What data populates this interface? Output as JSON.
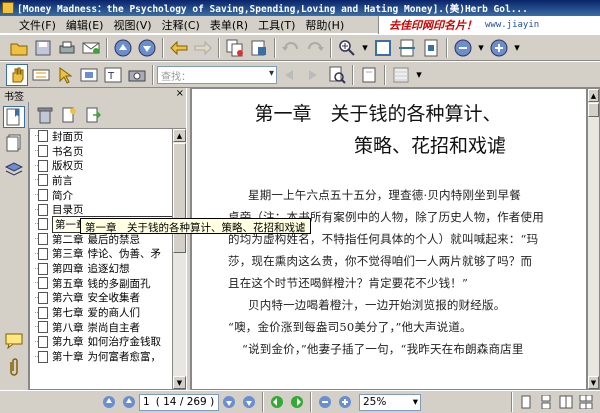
{
  "window": {
    "title": "[Money  Madness：the Psychology of Saving,Spending,Loving and Hating Money].(美)Herb Gol..."
  },
  "menu": {
    "items": [
      "文件(F)",
      "编辑(E)",
      "视图(V)",
      "注释(C)",
      "表单(R)",
      "工具(T)",
      "帮助(H)"
    ],
    "ad_brand": "去佳印网印名片！",
    "ad_sub": "www.jiayin"
  },
  "toolbar": {
    "find_placeholder": "查找："
  },
  "panel": {
    "title": "书签",
    "close": "×"
  },
  "bookmarks": [
    {
      "num": "",
      "label": "封面页"
    },
    {
      "num": "",
      "label": "书名页"
    },
    {
      "num": "",
      "label": "版权页"
    },
    {
      "num": "",
      "label": "前言"
    },
    {
      "num": "",
      "label": "简介"
    },
    {
      "num": "",
      "label": "目录页"
    },
    {
      "num": "第一章",
      "label": "关于钱的各种算计、策略、花招和戏谑",
      "selected": true
    },
    {
      "num": "第二章",
      "label": "最后的禁忌"
    },
    {
      "num": "第三章",
      "label": "悖论、伪善、矛"
    },
    {
      "num": "第四章",
      "label": "追逐幻想"
    },
    {
      "num": "第五章",
      "label": "钱的多副面孔"
    },
    {
      "num": "第六章",
      "label": "安全收集者"
    },
    {
      "num": "第七章",
      "label": "爱的商人们"
    },
    {
      "num": "第八章",
      "label": "崇尚自主者"
    },
    {
      "num": "第九章",
      "label": "如何治疗金钱取"
    },
    {
      "num": "第十章",
      "label": "为何富者愈富，"
    }
  ],
  "document": {
    "chapter_line1": "第一章　关于钱的各种算计、",
    "chapter_line2": "策略、花招和戏谑",
    "lines": [
      "星期一上午六点五十五分，理查德·贝内特刚坐到早餐",
      "桌旁（注：本书所有案例中的人物，除了历史人物，作者使用",
      "的均为虚构姓名，不特指任何具体的个人）就叫喊起来：“玛",
      "莎，现在熏肉这么贵，你不觉得咱们一人两片就够了吗？而",
      "且在这个时节还喝鲜橙汁？肯定要花不少钱！”",
      "贝内特一边喝着橙汁，一边开始浏览报的财经版。",
      "“噢，金价涨到每盎司50美分了，”他大声说道。",
      "“说到金价，”他妻子插了一句，“我昨天在布朗森商店里"
    ]
  },
  "tooltip": {
    "text": "第一章　关于钱的各种算计、策略、花招和戏谑"
  },
  "status": {
    "page_value": "1",
    "page_total": "( 14 / 269 )",
    "zoom": "25%"
  }
}
